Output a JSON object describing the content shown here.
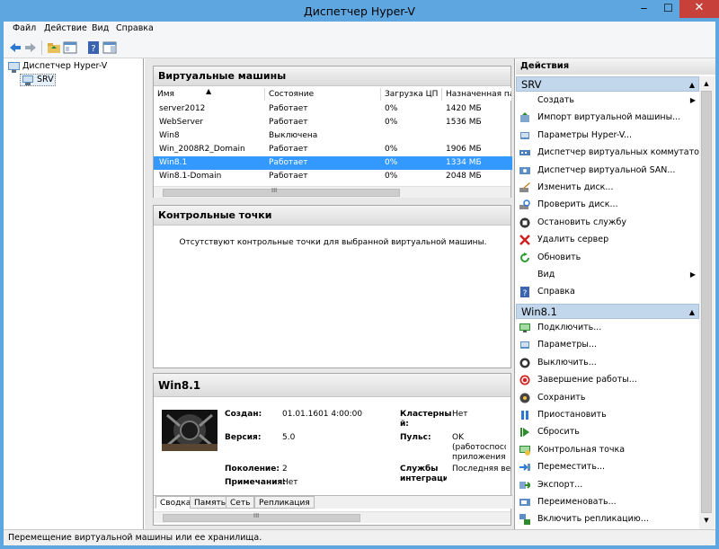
{
  "window": {
    "title": "Диспетчер Hyper-V",
    "minimize": "‒",
    "maximize": "☐",
    "close": "✕"
  },
  "menu": [
    "Файл",
    "Действие",
    "Вид",
    "Справка"
  ],
  "tree": {
    "root": "Диспетчер Hyper-V",
    "child": "SRV"
  },
  "vms": {
    "title": "Виртуальные машины",
    "columns": [
      "Имя",
      "Состояние",
      "Загрузка ЦП",
      "Назначенная пам"
    ],
    "rows": [
      {
        "name": "server2012",
        "state": "Работает",
        "cpu": "0%",
        "mem": "1420 МБ"
      },
      {
        "name": "WebServer",
        "state": "Работает",
        "cpu": "0%",
        "mem": "1536 МБ"
      },
      {
        "name": "Win8",
        "state": "Выключена",
        "cpu": "",
        "mem": ""
      },
      {
        "name": "Win_2008R2_Domain",
        "state": "Работает",
        "cpu": "0%",
        "mem": "1906 МБ"
      },
      {
        "name": "Win8.1",
        "state": "Работает",
        "cpu": "0%",
        "mem": "1334 МБ"
      },
      {
        "name": "Win8.1-Domain",
        "state": "Работает",
        "cpu": "0%",
        "mem": "2048 МБ"
      }
    ],
    "scroll_mark": "III"
  },
  "checkpoints": {
    "title": "Контрольные точки",
    "empty_text": "Отсутствуют контрольные точки для выбранной виртуальной машины."
  },
  "details": {
    "title": "Win8.1",
    "created_label": "Создан:",
    "created": "01.01.1601 4:00:00",
    "version_label": "Версия:",
    "version": "5.0",
    "generation_label": "Поколение:",
    "generation": "2",
    "notes_label": "Примечания:",
    "notes": "Нет",
    "cluster_label": "Кластерны й:",
    "cluster": "Нет",
    "heartbeat_label": "Пульс:",
    "heartbeat": "OK (работоспособны приложения)",
    "integration_label": "Службы интеграци",
    "integration": "Последняя верси",
    "tabs": [
      "Сводка",
      "Память",
      "Сеть",
      "Репликация"
    ],
    "scroll_mark": "III"
  },
  "actions": {
    "title": "Действия",
    "srv_head": "SRV",
    "srv_items": [
      {
        "label": "Создать",
        "icon": "blank-icon",
        "submenu": true
      },
      {
        "label": "Импорт виртуальной машины...",
        "icon": "import-icon"
      },
      {
        "label": "Параметры Hyper-V...",
        "icon": "settings-icon"
      },
      {
        "label": "Диспетчер виртуальных коммутато...",
        "icon": "switch-manager-icon"
      },
      {
        "label": "Диспетчер виртуальной SAN...",
        "icon": "san-manager-icon"
      },
      {
        "label": "Изменить диск...",
        "icon": "edit-disk-icon"
      },
      {
        "label": "Проверить диск...",
        "icon": "inspect-disk-icon"
      },
      {
        "label": "Остановить службу",
        "icon": "stop-service-icon"
      },
      {
        "label": "Удалить сервер",
        "icon": "remove-server-icon"
      },
      {
        "label": "Обновить",
        "icon": "refresh-icon"
      },
      {
        "label": "Вид",
        "icon": "blank-icon",
        "submenu": true
      },
      {
        "label": "Справка",
        "icon": "help-icon"
      }
    ],
    "vm_head": "Win8.1",
    "vm_items": [
      {
        "label": "Подключить...",
        "icon": "connect-icon"
      },
      {
        "label": "Параметры...",
        "icon": "vm-settings-icon"
      },
      {
        "label": "Выключить...",
        "icon": "turn-off-icon"
      },
      {
        "label": "Завершение работы...",
        "icon": "shutdown-icon"
      },
      {
        "label": "Сохранить",
        "icon": "save-icon"
      },
      {
        "label": "Приостановить",
        "icon": "pause-icon"
      },
      {
        "label": "Сбросить",
        "icon": "reset-icon"
      },
      {
        "label": "Контрольная точка",
        "icon": "checkpoint-icon"
      },
      {
        "label": "Переместить...",
        "icon": "move-icon"
      },
      {
        "label": "Экспорт...",
        "icon": "export-icon"
      },
      {
        "label": "Переименовать...",
        "icon": "rename-icon"
      },
      {
        "label": "Включить репликацию...",
        "icon": "replication-icon"
      }
    ]
  },
  "status": "Перемещение виртуальной машины или ее хранилища.",
  "colors": {
    "titlebar": "#5ea6e0",
    "selection": "#3399ff",
    "section_head": "#c2d7ec",
    "close": "#c7413a"
  }
}
